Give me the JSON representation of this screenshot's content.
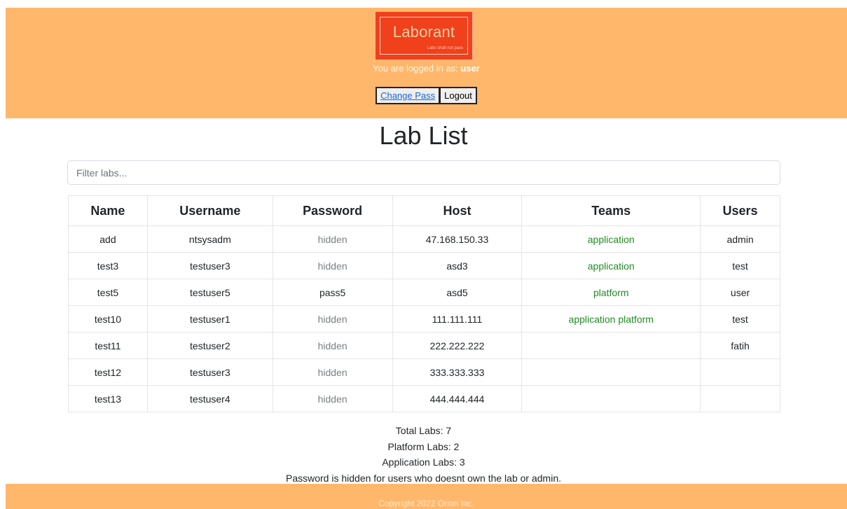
{
  "header": {
    "logo_title": "Laborant",
    "logo_subtitle": "Labs shall not pass",
    "logged_in_prefix": "You are logged in as:",
    "username": "user",
    "change_pass_label": "Change Pass",
    "logout_label": "Logout"
  },
  "page_title": "Lab List",
  "filter": {
    "placeholder": "Filter labs..."
  },
  "table": {
    "columns": [
      "Name",
      "Username",
      "Password",
      "Host",
      "Teams",
      "Users"
    ],
    "rows": [
      [
        "add",
        "ntsysadm",
        "hidden",
        "47.168.150.33",
        "application",
        "admin"
      ],
      [
        "test3",
        "testuser3",
        "hidden",
        "asd3",
        "application",
        "test"
      ],
      [
        "test5",
        "testuser5",
        "pass5",
        "asd5",
        "platform",
        "user"
      ],
      [
        "test10",
        "testuser1",
        "hidden",
        "111.111.111",
        "application platform",
        "test"
      ],
      [
        "test11",
        "testuser2",
        "hidden",
        "222.222.222",
        "",
        "fatih"
      ],
      [
        "test12",
        "testuser3",
        "hidden",
        "333.333.333",
        "",
        ""
      ],
      [
        "test13",
        "testuser4",
        "hidden",
        "444.444.444",
        "",
        ""
      ]
    ]
  },
  "summary": {
    "total": "Total Labs: 7",
    "platform": "Platform Labs: 2",
    "application": "Application Labs: 3",
    "note": "Password is hidden for users who doesnt own the lab or admin."
  },
  "footer": {
    "copyright": "Copyright 2022 Orion Inc."
  },
  "colors": {
    "header_bg": "#ffb86b",
    "logo_bg": "#f0401c",
    "team_text": "#228b22",
    "hidden_text": "#7b7f83",
    "link": "#1a66d9"
  }
}
